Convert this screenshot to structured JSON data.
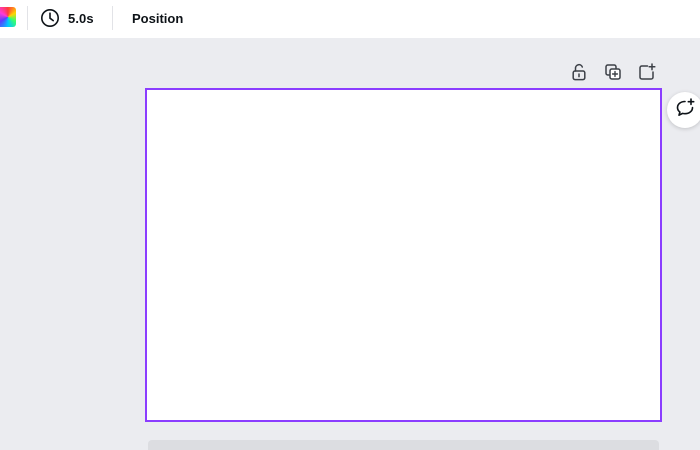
{
  "toolbar": {
    "color_swatch_icon": "rainbow-color-swatch-icon",
    "timer": {
      "icon": "clock-icon",
      "label": "5.0s"
    },
    "position_label": "Position"
  },
  "page_actions": [
    {
      "icon": "unlock-icon"
    },
    {
      "icon": "duplicate-page-icon"
    },
    {
      "icon": "add-page-icon"
    }
  ],
  "comment": {
    "icon": "add-comment-icon"
  },
  "colors": {
    "selection_border": "#8b3dff",
    "workspace_bg": "#ebecf0",
    "toolbar_bg": "#ffffff",
    "text": "#0e1318"
  }
}
